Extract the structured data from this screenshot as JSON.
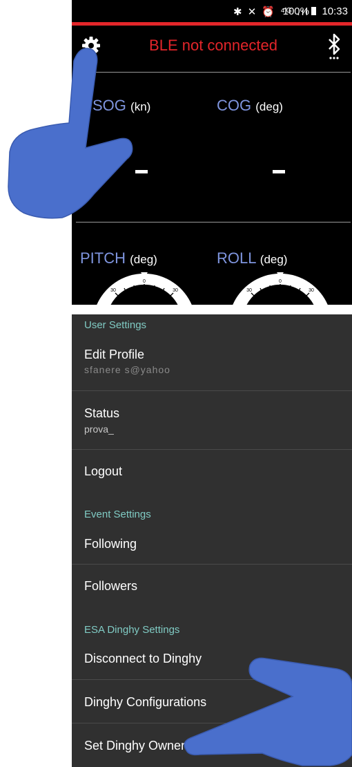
{
  "top_screen": {
    "statusbar": {
      "icons": "✱ ✕ ⏰ ⁴ᴳ .ıl",
      "battery": "100%",
      "time": "10:33"
    },
    "header": {
      "ble_status": "BLE not connected",
      "ble_status_color": "#e3252a"
    },
    "metrics": {
      "sog": {
        "label": "SOG",
        "unit": "(kn)",
        "value": "-"
      },
      "cog": {
        "label": "COG",
        "unit": "(deg)",
        "value": "-"
      },
      "pitch": {
        "label": "PITCH",
        "unit": "(deg)"
      },
      "roll": {
        "label": "ROLL",
        "unit": "(deg)"
      }
    },
    "dial": {
      "ticks": [
        "30",
        "0",
        "30"
      ]
    },
    "colors": {
      "accent_label": "#7f95df",
      "background": "#000000",
      "status_line": "#e4262a"
    }
  },
  "settings_screen": {
    "sections": [
      {
        "header": "User Settings",
        "items": [
          {
            "title": "Edit Profile",
            "subtitle": "sfanere s@yahoo"
          },
          {
            "title": "Status",
            "subtitle": "prova_"
          },
          {
            "title": "Logout"
          }
        ]
      },
      {
        "header": "Event Settings",
        "items": [
          {
            "title": "Following"
          },
          {
            "title": "Followers"
          }
        ]
      },
      {
        "header": "ESA Dinghy Settings",
        "items": [
          {
            "title": "Disconnect to Dinghy"
          },
          {
            "title": "Dinghy Configurations"
          },
          {
            "title": "Set Dinghy Owner"
          }
        ]
      }
    ],
    "colors": {
      "background": "#303030",
      "section_header": "#80cbc4"
    }
  },
  "overlays": {
    "hand_color": "#4a6fcc",
    "icons": [
      "pointing-hand-icon"
    ]
  }
}
